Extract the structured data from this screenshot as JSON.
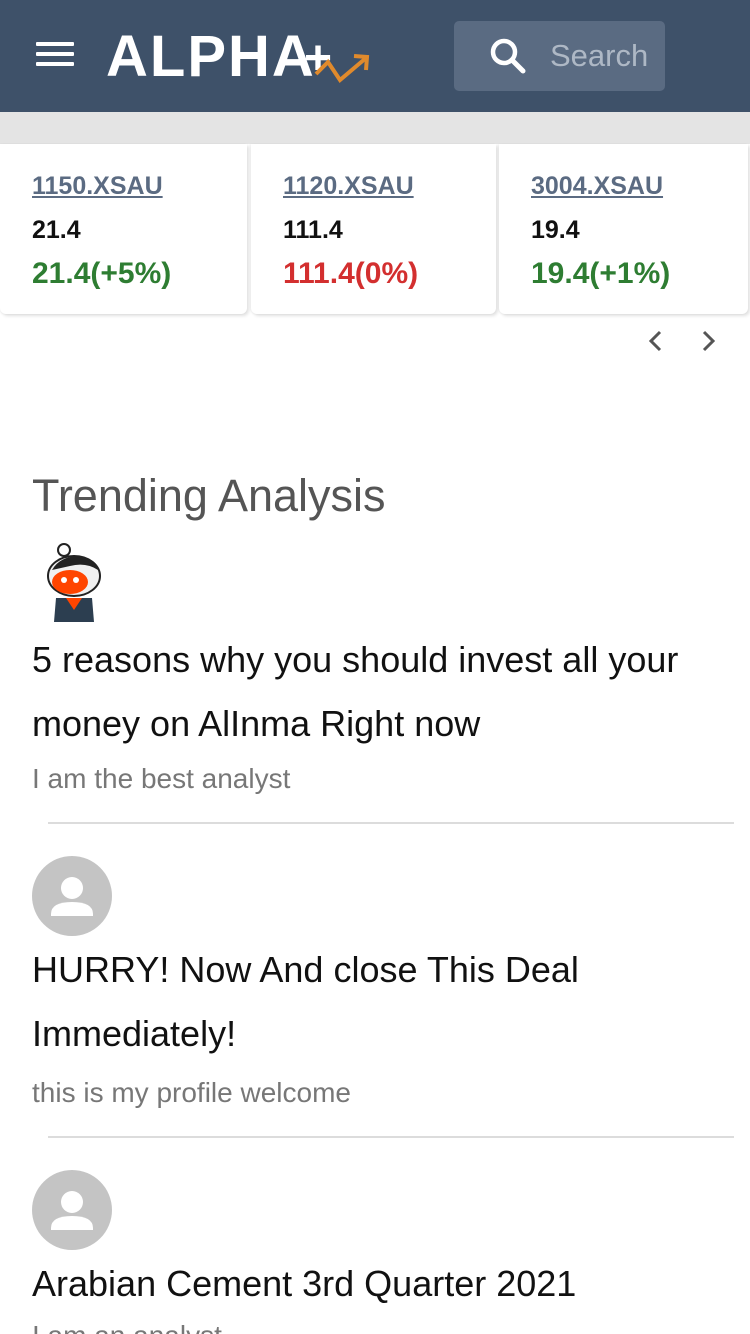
{
  "header": {
    "logo_text": "ALPHA+",
    "search_placeholder": "Search"
  },
  "tickers": [
    {
      "symbol": "1150.XSAU",
      "price": "21.4",
      "change": "21.4(+5%)",
      "trend": "up"
    },
    {
      "symbol": "1120.XSAU",
      "price": "111.4",
      "change": "111.4(0%)",
      "trend": "down"
    },
    {
      "symbol": "3004.XSAU",
      "price": "19.4",
      "change": "19.4(+1%)",
      "trend": "up"
    }
  ],
  "colors": {
    "header_bg": "#3e5169",
    "up": "#2e7d32",
    "down": "#d32f2f",
    "link": "#5b6b82",
    "logo_accent": "#e08a2c"
  },
  "trending": {
    "title": "Trending Analysis",
    "posts": [
      {
        "title": " 5 reasons why you should invest all your money on AlInma Right now",
        "subtitle": "I am the best analyst",
        "avatar": "custom-avatar"
      },
      {
        "title": " HURRY! Now And close This Deal Immediately!",
        "subtitle": "this is my profile welcome",
        "avatar": "default-avatar"
      },
      {
        "title": " Arabian Cement 3rd Quarter 2021",
        "subtitle": "I am an analyst",
        "avatar": "default-avatar"
      }
    ]
  }
}
